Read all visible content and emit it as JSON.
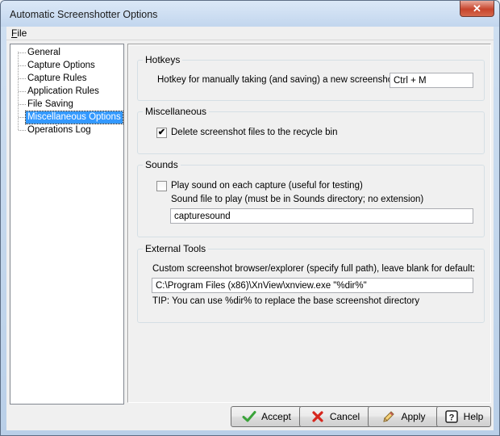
{
  "window": {
    "title": "Automatic Screenshotter Options",
    "close_glyph": "✕"
  },
  "menu": {
    "file_accel": "F",
    "file_rest": "ile"
  },
  "tree": {
    "items": [
      {
        "label": "General",
        "selected": false
      },
      {
        "label": "Capture Options",
        "selected": false
      },
      {
        "label": "Capture Rules",
        "selected": false
      },
      {
        "label": "Application Rules",
        "selected": false
      },
      {
        "label": "File Saving",
        "selected": false
      },
      {
        "label": "Miscellaneous Options",
        "selected": true
      },
      {
        "label": "Operations Log",
        "selected": false
      }
    ]
  },
  "hotkeys": {
    "legend": "Hotkeys",
    "label": "Hotkey for manually taking (and saving) a new screenshot:",
    "value": "Ctrl + M"
  },
  "misc": {
    "legend": "Miscellaneous",
    "recycle_label": "Delete screenshot files to the recycle bin",
    "recycle_checked": true
  },
  "sounds": {
    "legend": "Sounds",
    "play_label": "Play sound on each capture (useful for testing)",
    "play_checked": false,
    "file_label": "Sound file to play (must be in Sounds directory; no extension)",
    "file_value": "capturesound"
  },
  "external": {
    "legend": "External Tools",
    "label": "Custom screenshot browser/explorer (specify full path), leave blank for default:",
    "value": "C:\\Program Files (x86)\\XnView\\xnview.exe \"%dir%\"",
    "tip": "TIP: You can use %dir% to replace the base screenshot directory"
  },
  "buttons": {
    "accept": {
      "label": "Accept",
      "icon": "checkmark-icon"
    },
    "cancel": {
      "label": "Cancel",
      "icon": "red-x-icon"
    },
    "apply": {
      "label": "Apply",
      "icon": "pencil-icon"
    },
    "help": {
      "label": "Help",
      "icon": "help-icon"
    }
  },
  "colors": {
    "selection": "#3399ff",
    "accept_icon": "#3aa33a",
    "cancel_icon": "#d6261d"
  }
}
